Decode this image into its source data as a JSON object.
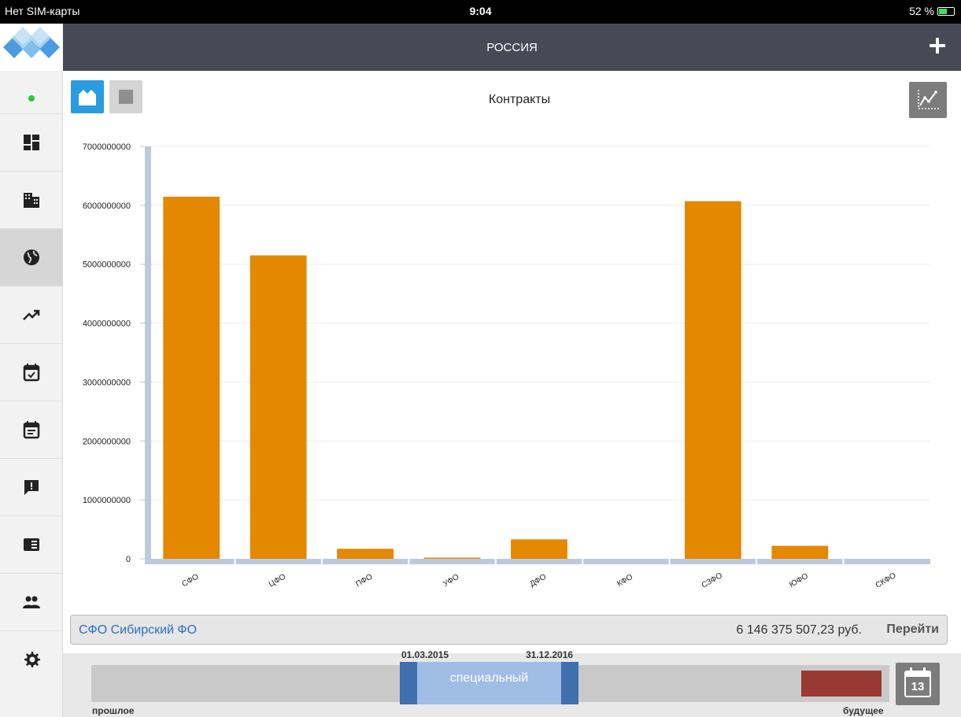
{
  "statusbar": {
    "carrier": "Нет SIM-карты",
    "time": "9:04",
    "battery": "52 %"
  },
  "header": {
    "title": "РОССИЯ"
  },
  "toolbar": {
    "chart_title": "Контракты"
  },
  "sidebar": {
    "items": [
      {
        "icon": "dashboard-icon"
      },
      {
        "icon": "building-icon"
      },
      {
        "icon": "globe-icon",
        "active": true
      },
      {
        "icon": "trending-up-icon"
      },
      {
        "icon": "calendar-check-icon"
      },
      {
        "icon": "calendar-note-icon"
      },
      {
        "icon": "alert-message-icon"
      },
      {
        "icon": "book-icon"
      },
      {
        "icon": "people-icon"
      },
      {
        "icon": "gear-icon"
      }
    ]
  },
  "chart_data": {
    "type": "bar",
    "title": "Контракты",
    "categories": [
      "СФО",
      "ЦФО",
      "ПФО",
      "УФО",
      "ДФО",
      "КФО",
      "СЗФО",
      "ЮФО",
      "СКФО"
    ],
    "values": [
      6146375507.23,
      5150000000,
      170000000,
      20000000,
      330000000,
      0,
      6070000000,
      220000000,
      0
    ],
    "ylim": [
      0,
      7000000000
    ],
    "yticks": [
      "0",
      "1000000000",
      "2000000000",
      "3000000000",
      "4000000000",
      "5000000000",
      "6000000000",
      "7000000000"
    ],
    "bar_color": "#e38800",
    "axis_color": "#bccbdc",
    "grid": true
  },
  "infobar": {
    "name": "СФО Сибирский ФО",
    "amount": "6 146 375 507,23 руб.",
    "go": "Перейти"
  },
  "timeline": {
    "start": "01.03.2015",
    "end": "31.12.2016",
    "range_label": "специальный",
    "past": "прошлое",
    "future": "будущее",
    "calendar_day": "13"
  },
  "colors": {
    "accent": "#2a9be0",
    "header": "#474a55",
    "range": "#9fbde5",
    "future_block": "#983a33"
  }
}
